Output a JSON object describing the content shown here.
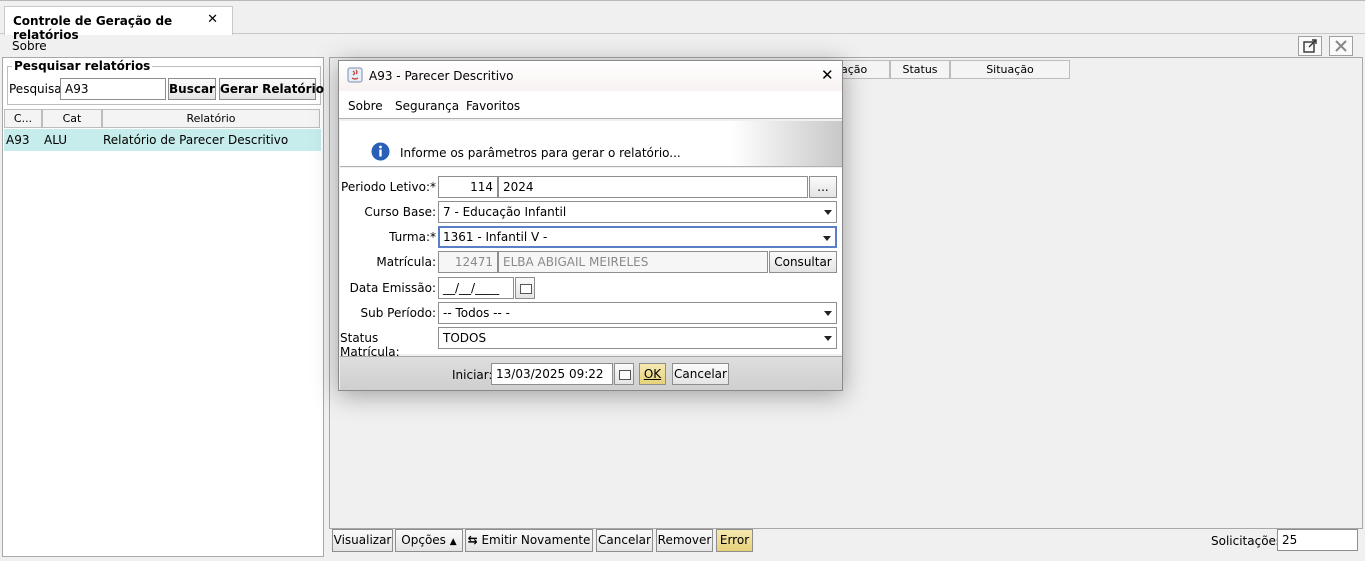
{
  "tab": {
    "title": "Controle de Geração de relatórios",
    "close": "✕"
  },
  "menubar": {
    "sobre": "Sobre"
  },
  "search": {
    "legend": "Pesquisar relatórios",
    "label": "Pesquisa:",
    "value": "A93",
    "buscar": "Buscar",
    "gerar": "Gerar Relatório"
  },
  "left_table": {
    "headers": [
      "C...",
      "Cat",
      "Relatório"
    ],
    "rows": [
      {
        "code": "A93",
        "cat": "ALU",
        "name": "Relatório de Parecer Descritivo"
      }
    ]
  },
  "right_table": {
    "headers": [
      "ação",
      "Status",
      "Situação"
    ]
  },
  "dialog": {
    "title": "A93 - Parecer Descritivo",
    "close": "✕",
    "menu": [
      "Sobre",
      "Segurança",
      "Favoritos"
    ],
    "info": "Informe os parâmetros para gerar o relatório...",
    "fields": {
      "periodo_label": "Periodo Letivo:*",
      "periodo_code": "114",
      "periodo_value": "2024",
      "periodo_btn": "...",
      "curso_label": "Curso Base:",
      "curso_value": "7 - Educação Infantil",
      "turma_label": "Turma:*",
      "turma_value": "1361 - Infantil V -",
      "matricula_label": "Matrícula:",
      "matricula_code": "12471",
      "matricula_name": "ELBA ABIGAIL MEIRELES",
      "consultar": "Consultar",
      "data_label": "Data Emissão:",
      "data_value": "__/__/____",
      "subperiodo_label": "Sub Período:",
      "subperiodo_value": "-- Todos -- -",
      "status_label": "Status Matrícula:",
      "status_value": "TODOS"
    },
    "footer": {
      "iniciar_label": "Iniciar:",
      "iniciar_value": "13/03/2025 09:22",
      "ok": "OK",
      "cancelar": "Cancelar"
    }
  },
  "bottombar": {
    "visualizar": "Visualizar",
    "opcoes": "Opções",
    "emitir": "Emitir Novamente",
    "cancelar": "Cancelar",
    "remover": "Remover",
    "error": "Error",
    "solicitacoes_label": "Solicitações:",
    "solicitacoes_value": "25"
  },
  "colors": {
    "selected_row": "#c7ecec",
    "ok_button": "#e6d27a",
    "info_icon": "#2a5fb8"
  }
}
